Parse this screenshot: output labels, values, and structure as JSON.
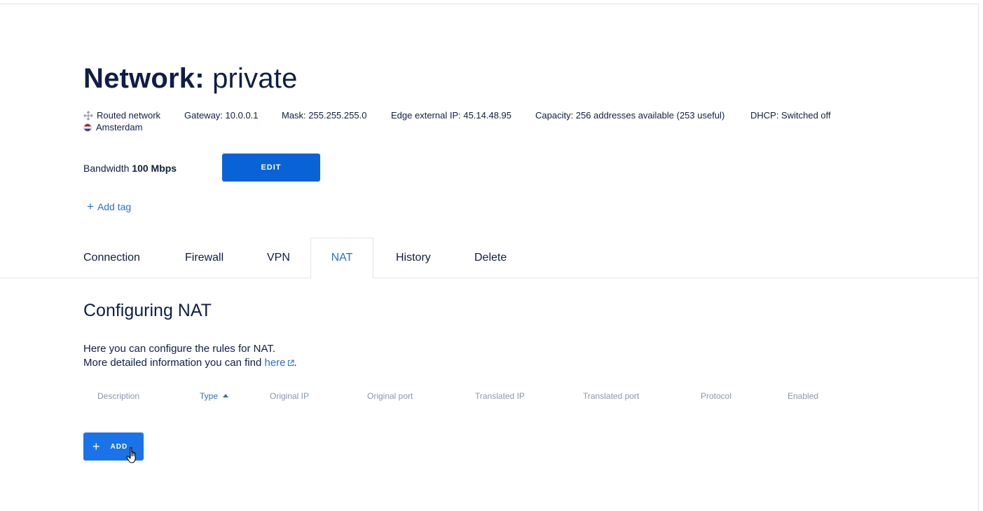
{
  "header": {
    "title_key": "Network:",
    "title_value": "private"
  },
  "meta": {
    "network_type": "Routed network",
    "location": "Amsterdam",
    "gateway": "Gateway: 10.0.0.1",
    "mask": "Mask: 255.255.255.0",
    "edge_ip": "Edge external IP: 45.14.48.95",
    "capacity": "Capacity: 256 addresses available (253 useful)",
    "dhcp": "DHCP: Switched off"
  },
  "bandwidth": {
    "label": "Bandwidth",
    "value": "100 Mbps",
    "edit_label": "EDIT"
  },
  "tags": {
    "add_label": "Add tag"
  },
  "tabs": [
    {
      "label": "Connection"
    },
    {
      "label": "Firewall"
    },
    {
      "label": "VPN"
    },
    {
      "label": "NAT",
      "active": true
    },
    {
      "label": "History"
    },
    {
      "label": "Delete"
    }
  ],
  "nat": {
    "title": "Configuring NAT",
    "desc_line1": "Here you can configure the rules for NAT.",
    "desc_line2_prefix": "More detailed information you can find",
    "desc_link": "here",
    "desc_line2_suffix": ".",
    "columns": [
      "Description",
      "Type",
      "Original IP",
      "Original port",
      "Translated IP",
      "Translated port",
      "Protocol",
      "Enabled"
    ],
    "sorted_column": "Type",
    "add_label": "ADD"
  },
  "colors": {
    "primary": "#0a63d6",
    "link": "#2a6fd0",
    "text": "#0f1e45",
    "muted": "#8a96ab"
  }
}
